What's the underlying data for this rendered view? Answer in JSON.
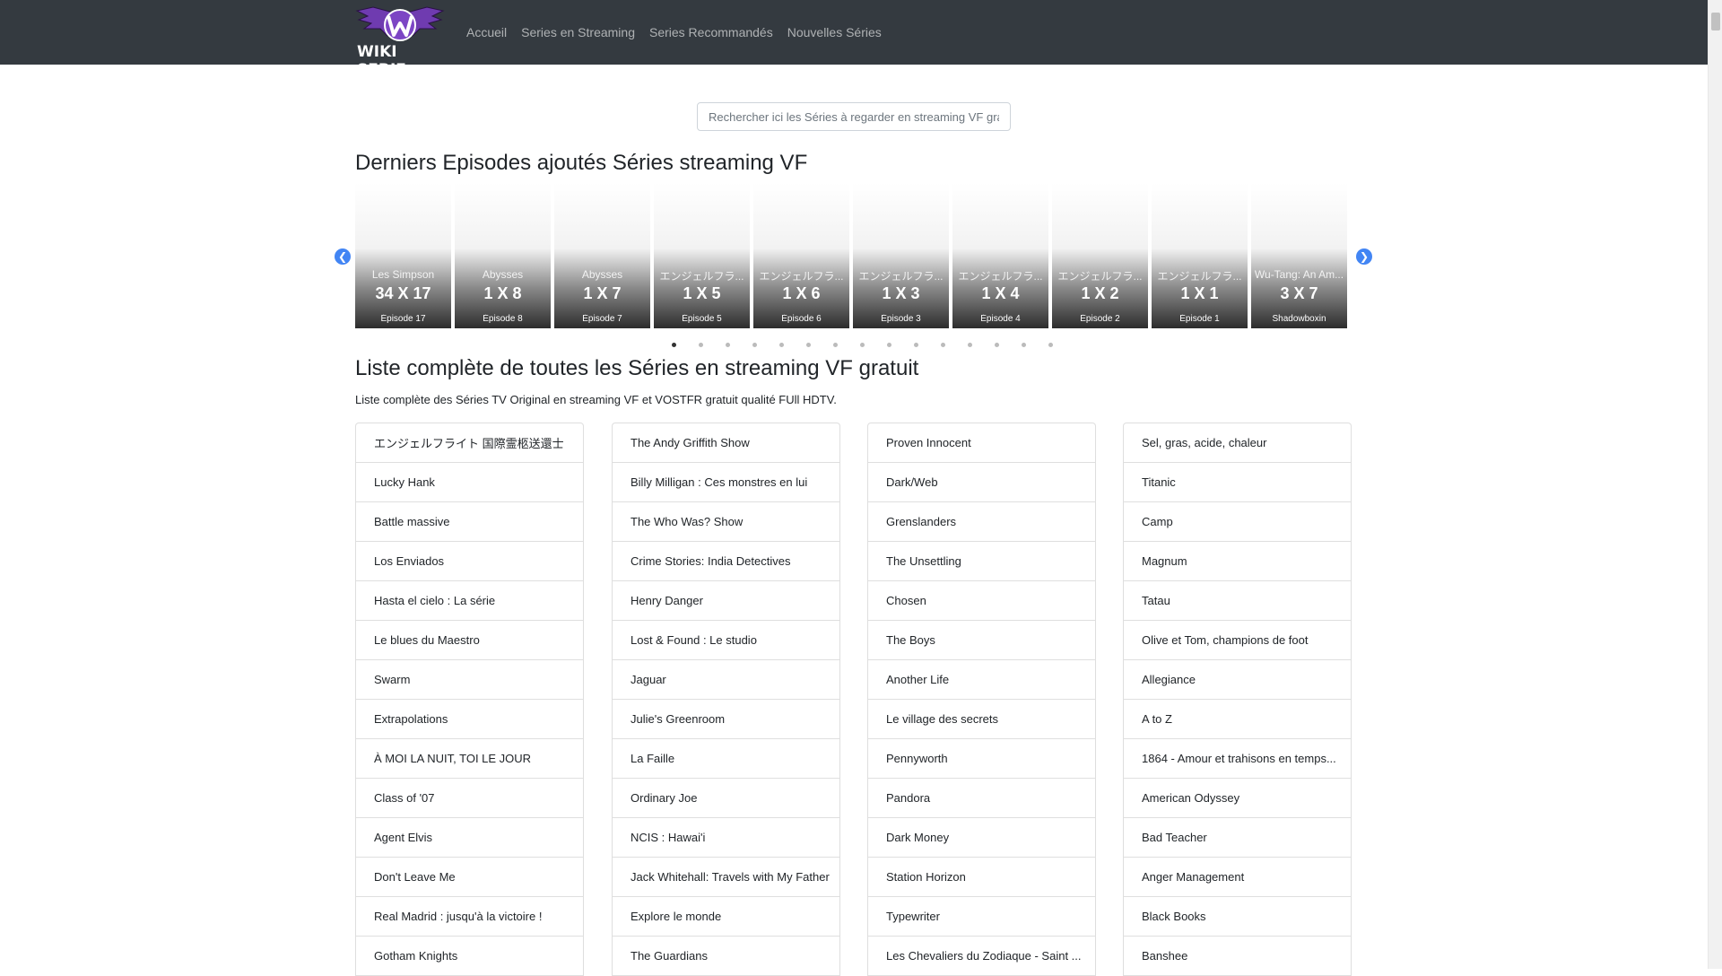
{
  "brand": {
    "logo_text": "WIKI SERIE",
    "accent": "#5a2d91"
  },
  "nav": {
    "items": [
      "Accueil",
      "Series en Streaming",
      "Series Recommandés",
      "Nouvelles Séries"
    ]
  },
  "search": {
    "placeholder": "Rechercher ici les Séries à regarder en streaming VF gra"
  },
  "latest": {
    "title": "Derniers Episodes ajoutés Séries streaming VF",
    "cards": [
      {
        "title": "Les Simpson",
        "ep": "34 X 17",
        "sub": "Épisode 17"
      },
      {
        "title": "Abysses",
        "ep": "1 X 8",
        "sub": "Épisode 8"
      },
      {
        "title": "Abysses",
        "ep": "1 X 7",
        "sub": "Épisode 7"
      },
      {
        "title": "エンジェルフラ...",
        "ep": "1 X 5",
        "sub": "Épisode 5"
      },
      {
        "title": "エンジェルフラ...",
        "ep": "1 X 6",
        "sub": "Épisode 6"
      },
      {
        "title": "エンジェルフラ...",
        "ep": "1 X 3",
        "sub": "Épisode 3"
      },
      {
        "title": "エンジェルフラ...",
        "ep": "1 X 4",
        "sub": "Épisode 4"
      },
      {
        "title": "エンジェルフラ...",
        "ep": "1 X 2",
        "sub": "Épisode 2"
      },
      {
        "title": "エンジェルフラ...",
        "ep": "1 X 1",
        "sub": "Épisode 1"
      },
      {
        "title": "Wu-Tang: An Am...",
        "ep": "3 X 7",
        "sub": "Shadowboxin"
      }
    ],
    "dot_count": 15,
    "active_dot": 0
  },
  "full": {
    "title": "Liste complète de toutes les Séries en streaming VF gratuit",
    "subtitle": "Liste complète des Séries TV Original en streaming VF et VOSTFR gratuit qualité FUll HDTV.",
    "columns": [
      [
        "エンジェルフライト 国際霊柩送還士",
        "Lucky Hank",
        "Battle massive",
        "Los Enviados",
        "Hasta el cielo : La série",
        "Le blues du Maestro",
        "Swarm",
        "Extrapolations",
        "À MOI LA NUIT, TOI LE JOUR",
        "Class of '07",
        "Agent Elvis",
        "Don't Leave Me",
        "Real Madrid : jusqu'à la victoire !",
        "Gotham Knights"
      ],
      [
        "The Andy Griffith Show",
        "Billy Milligan : Ces monstres en lui",
        "The Who Was? Show",
        "Crime Stories: India Detectives",
        "Henry Danger",
        "Lost & Found : Le studio",
        "Jaguar",
        "Julie's Greenroom",
        "La Faille",
        "Ordinary Joe",
        "NCIS : Hawai'i",
        "Jack Whitehall: Travels with My Father",
        "Explore le monde",
        "The Guardians"
      ],
      [
        "Proven Innocent",
        "Dark/Web",
        "Grenslanders",
        "The Unsettling",
        "Chosen",
        "The Boys",
        "Another Life",
        "Le village des secrets",
        "Pennyworth",
        "Pandora",
        "Dark Money",
        "Station Horizon",
        "Typewriter",
        "Les Chevaliers du Zodiaque - Saint ..."
      ],
      [
        "Sel, gras, acide, chaleur",
        "Titanic",
        "Camp",
        "Magnum",
        "Tatau",
        "Olive et Tom, champions de foot",
        "Allegiance",
        "A to Z",
        "1864 - Amour et trahisons en temps...",
        "American Odyssey",
        "Bad Teacher",
        "Anger Management",
        "Black Books",
        "Banshee"
      ]
    ]
  }
}
